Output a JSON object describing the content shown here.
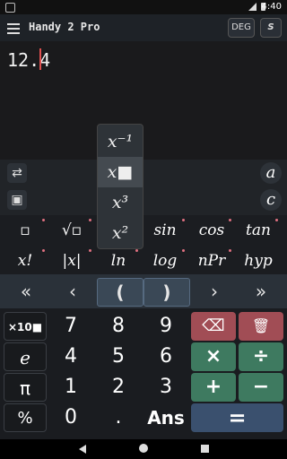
{
  "status": {
    "time": "4:40"
  },
  "titlebar": {
    "title": "Handy 2 Pro",
    "deg_label": "DEG",
    "s_label": "S"
  },
  "display": {
    "expression": "12.4"
  },
  "popup": {
    "items": [
      "x⁻¹",
      "x■",
      "x³",
      "x²"
    ],
    "selected_index": 1
  },
  "side": {
    "letter_a": "a",
    "letter_c": "c",
    "refresh_icon": "⇄",
    "save_icon": "▣"
  },
  "functions": {
    "row1": [
      "▫",
      "√▫",
      "",
      "sin",
      "cos",
      "tan"
    ],
    "row2": [
      "x!",
      "|x|",
      "ln",
      "log",
      "nPr",
      "hyp"
    ]
  },
  "arrows": [
    "«",
    "‹",
    "(",
    ")",
    "›",
    "»"
  ],
  "keypad": {
    "side": [
      "×10■",
      "e",
      "π",
      "%"
    ],
    "row1": [
      "7",
      "8",
      "9"
    ],
    "row2": [
      "4",
      "5",
      "6"
    ],
    "row3": [
      "1",
      "2",
      "3"
    ],
    "row4": [
      "0",
      ".",
      "Ans"
    ],
    "ops": {
      "backspace": "⌫",
      "clear": "🗑",
      "multiply": "×",
      "divide": "÷",
      "plus": "+",
      "minus": "−",
      "equals": "="
    }
  },
  "colors": {
    "op_green": "#3e7a60",
    "delete_red": "#a14d55",
    "equals_blue": "#3a506e",
    "accent_dot": "#e07080"
  }
}
